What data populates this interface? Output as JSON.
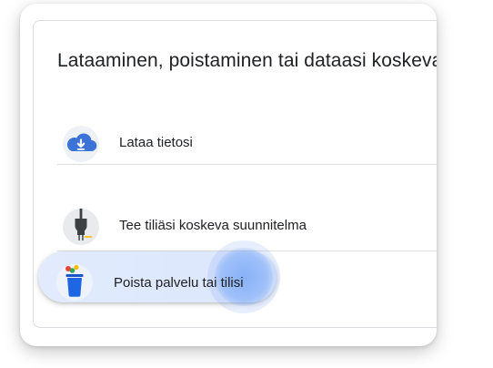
{
  "panel": {
    "title": "Lataaminen, poistaminen tai dataasi koskeva suunnitelma"
  },
  "rows": [
    {
      "label": "Lataa tietosi",
      "icon": "cloud-download-icon"
    },
    {
      "label": "Tee tiliäsi koskeva suunnitelma",
      "icon": "power-plug-icon"
    },
    {
      "label": "Poista palvelu tai tilisi",
      "icon": "trash-bin-icon"
    }
  ],
  "colors": {
    "accent": "#4285f4",
    "cloud": "#3b73d6",
    "icon_bg": "#e8eaed",
    "text": "#202124",
    "divider": "#e0e0e0",
    "highlight": "#e0eafd"
  },
  "state": {
    "highlighted_row": "Poista palvelu tai tilisi"
  }
}
